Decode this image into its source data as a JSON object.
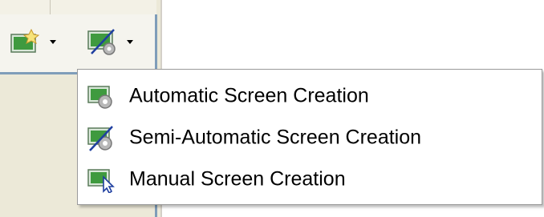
{
  "toolbar": {
    "buttons": [
      {
        "icon": "new-screen-icon",
        "has_dropdown": true
      },
      {
        "icon": "semi-automatic-screen-icon",
        "has_dropdown": true
      }
    ]
  },
  "menu": {
    "items": [
      {
        "label": "Automatic Screen Creation",
        "icon": "gear-screen-icon"
      },
      {
        "label": "Semi-Automatic Screen Creation",
        "icon": "semi-automatic-screen-icon"
      },
      {
        "label": "Manual Screen Creation",
        "icon": "cursor-screen-icon"
      }
    ]
  },
  "colors": {
    "screen_green": "#3f9a3f",
    "screen_border": "#6b8e6b",
    "panel_border": "#7f9db9",
    "menu_border": "#9a9a9a"
  }
}
